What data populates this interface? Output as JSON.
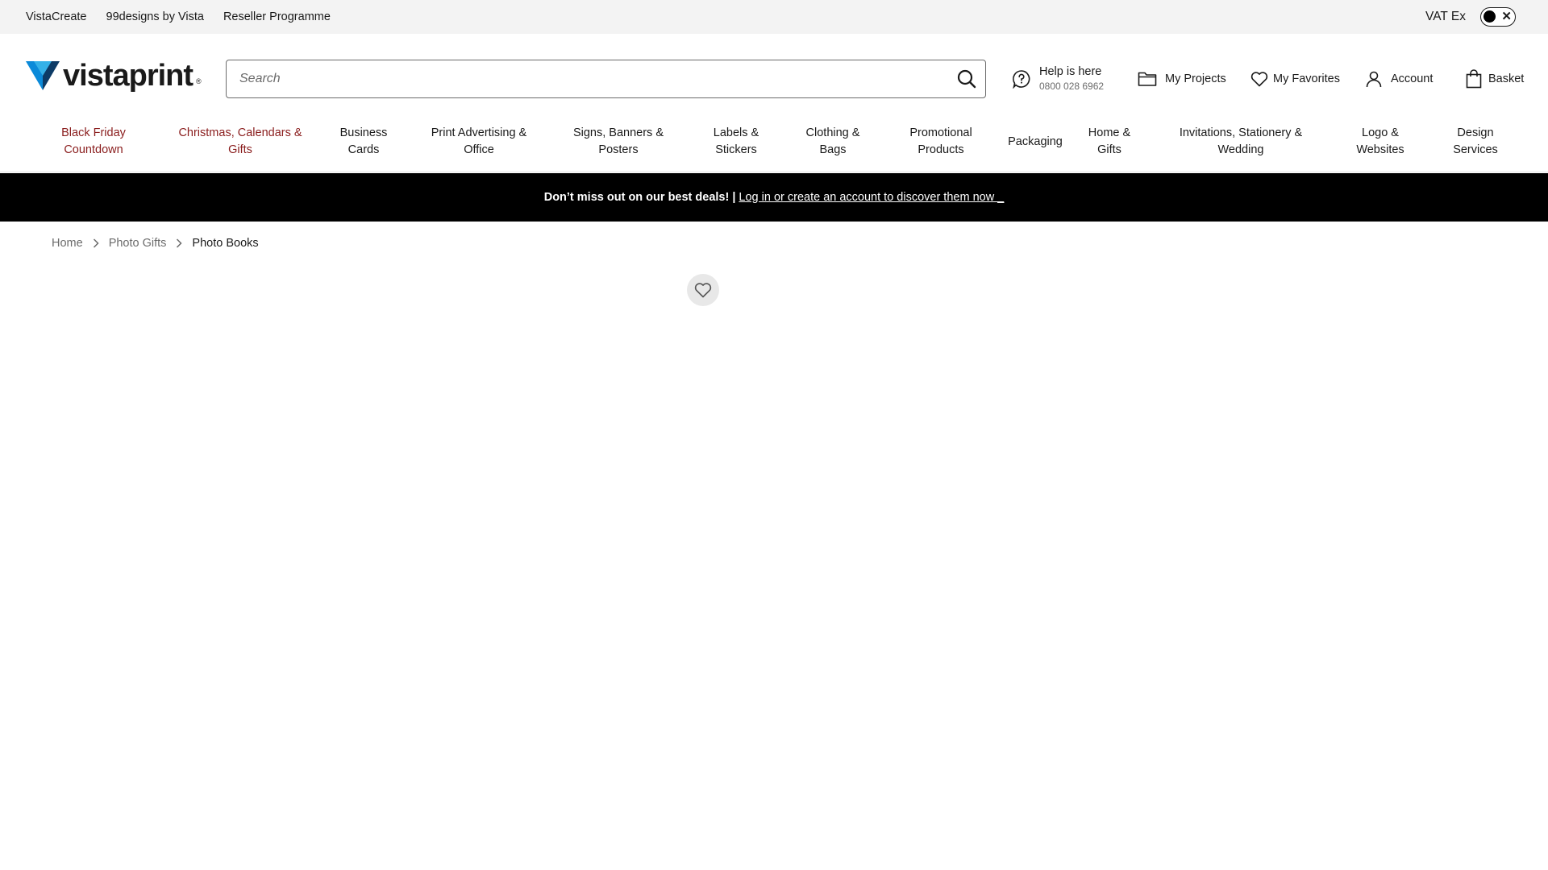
{
  "topbar": {
    "links": [
      "VistaCreate",
      "99designs by Vista",
      "Reseller Programme"
    ],
    "vat_label": "VAT Ex"
  },
  "header": {
    "logo_text": "vistaprint",
    "logo_reg": "®",
    "search": {
      "placeholder": "Search",
      "value": ""
    },
    "help": {
      "label": "Help is here",
      "phone": "0800 028 6962"
    },
    "projects_label": "My Projects",
    "favorites_label": "My Favorites",
    "account_label": "Account",
    "basket_label": "Basket"
  },
  "nav": {
    "items": [
      {
        "label": "Black Friday\nCountdown"
      },
      {
        "label": "Christmas, Calendars &\nGifts"
      },
      {
        "label": "Business\nCards"
      },
      {
        "label": "Print Advertising &\nOffice"
      },
      {
        "label": "Signs, Banners &\nPosters"
      },
      {
        "label": "Labels &\nStickers"
      },
      {
        "label": "Clothing &\nBags"
      },
      {
        "label": "Promotional\nProducts"
      },
      {
        "label": "Packaging"
      },
      {
        "label": "Home &\nGifts"
      },
      {
        "label": "Invitations, Stationery &\nWedding"
      },
      {
        "label": "Logo &\nWebsites"
      },
      {
        "label": "Design\nServices"
      }
    ]
  },
  "banner": {
    "bold_text": "Don’t miss out on our best deals! |",
    "link_text": "Log in or create an account to discover them now _"
  },
  "breadcrumb": {
    "items": [
      "Home",
      "Photo Gifts"
    ],
    "current": "Photo Books"
  },
  "colors": {
    "promo_text": "#8a1d1d",
    "logo_blue": "#0b8ad9",
    "logo_dark": "#0d3b66",
    "banner_bg": "#000000",
    "topbar_bg": "#f3f3f3"
  },
  "icons": {
    "search": "search-icon",
    "help": "question-bubble-icon",
    "projects": "folder-icon",
    "favorites": "heart-icon",
    "account": "user-icon",
    "basket": "shopping-bag-icon",
    "breadcrumb_separator": "chevron-right-icon"
  }
}
